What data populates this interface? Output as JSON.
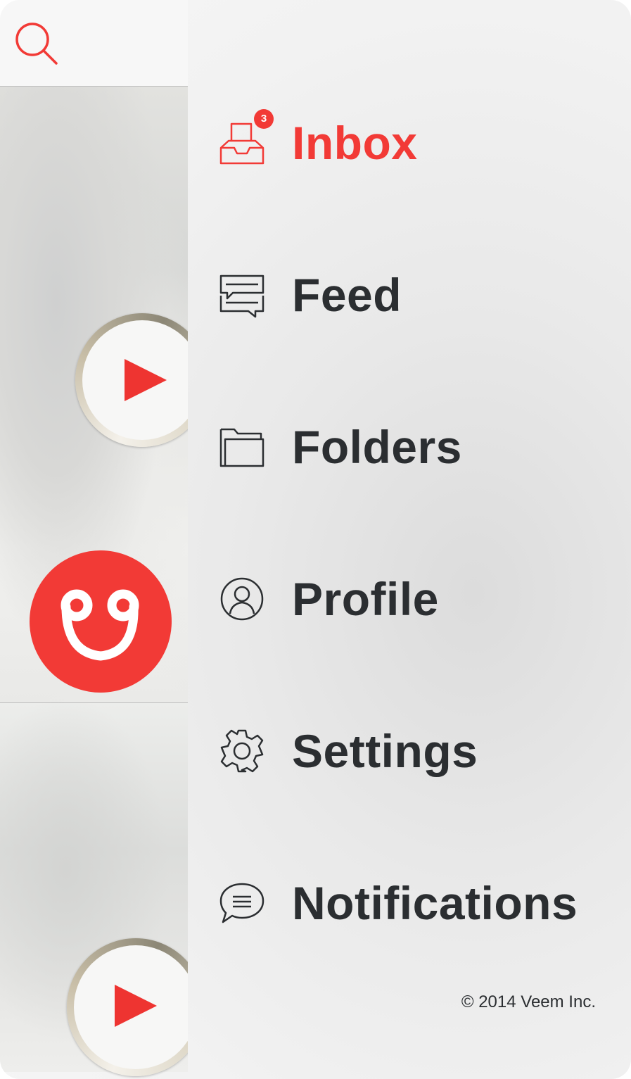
{
  "menu": {
    "items": [
      {
        "label": "Inbox",
        "icon": "inbox-icon",
        "active": true,
        "badge": "3"
      },
      {
        "label": "Feed",
        "icon": "feed-icon",
        "active": false
      },
      {
        "label": "Folders",
        "icon": "folder-icon",
        "active": false
      },
      {
        "label": "Profile",
        "icon": "profile-icon",
        "active": false
      },
      {
        "label": "Settings",
        "icon": "gear-icon",
        "active": false
      },
      {
        "label": "Notifications",
        "icon": "chat-bubble-icon",
        "active": false
      }
    ]
  },
  "footer": {
    "copyright": "© 2014 Veem Inc."
  },
  "colors": {
    "accent": "#f23a36",
    "text": "#2b2e31"
  }
}
